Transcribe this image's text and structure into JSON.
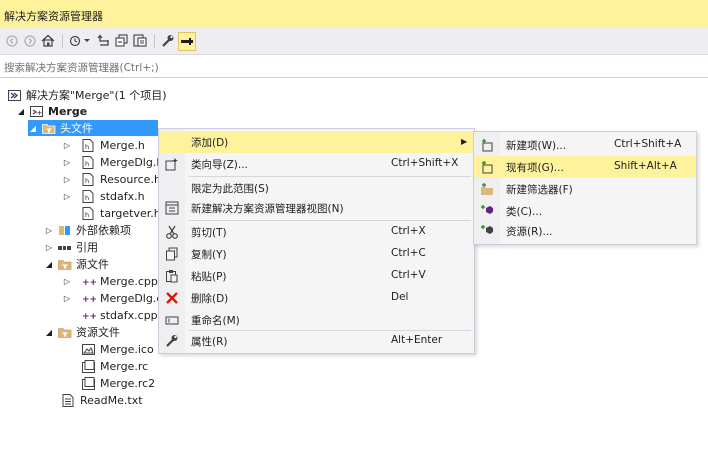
{
  "window": {
    "title": "解决方案资源管理器"
  },
  "search": {
    "placeholder": "搜索解决方案资源管理器(Ctrl+;)"
  },
  "toolbar": {
    "icons": [
      "back-icon",
      "forward-icon",
      "home-icon",
      "history-icon",
      "sync-icon",
      "collapse-all-icon",
      "show-all-files-icon",
      "properties-icon",
      "pin-icon"
    ]
  },
  "tree": {
    "solution": "解决方案\"Merge\"(1 个项目)",
    "project": "Merge",
    "headers_folder": "头文件",
    "headers": [
      "Merge.h",
      "MergeDlg.h",
      "Resource.h",
      "stdafx.h",
      "targetver.h"
    ],
    "external_deps": "外部依赖项",
    "references": "引用",
    "source_folder": "源文件",
    "sources": [
      "Merge.cpp",
      "MergeDlg.cpp",
      "stdafx.cpp"
    ],
    "resource_folder": "资源文件",
    "resources": [
      "Merge.ico",
      "Merge.rc",
      "Merge.rc2"
    ],
    "readme": "ReadMe.txt"
  },
  "context_menu": {
    "items": [
      {
        "label": "添加(D)",
        "shortcut": "",
        "submenu": true
      },
      {
        "label": "类向导(Z)...",
        "shortcut": "Ctrl+Shift+X"
      },
      {
        "label": "限定为此范围(S)",
        "shortcut": ""
      },
      {
        "label": "新建解决方案资源管理器视图(N)",
        "shortcut": ""
      },
      {
        "label": "剪切(T)",
        "shortcut": "Ctrl+X"
      },
      {
        "label": "复制(Y)",
        "shortcut": "Ctrl+C"
      },
      {
        "label": "粘贴(P)",
        "shortcut": "Ctrl+V"
      },
      {
        "label": "删除(D)",
        "shortcut": "Del"
      },
      {
        "label": "重命名(M)",
        "shortcut": ""
      },
      {
        "label": "属性(R)",
        "shortcut": "Alt+Enter"
      }
    ]
  },
  "submenu": {
    "items": [
      {
        "label": "新建项(W)...",
        "shortcut": "Ctrl+Shift+A"
      },
      {
        "label": "现有项(G)...",
        "shortcut": "Shift+Alt+A"
      },
      {
        "label": "新建筛选器(F)",
        "shortcut": ""
      },
      {
        "label": "类(C)...",
        "shortcut": ""
      },
      {
        "label": "资源(R)...",
        "shortcut": ""
      }
    ]
  },
  "colors": {
    "title_bg": "#fff29d",
    "selection": "#3399ff",
    "menu_bg": "#f5f5f5",
    "delete_red": "#e51400"
  }
}
